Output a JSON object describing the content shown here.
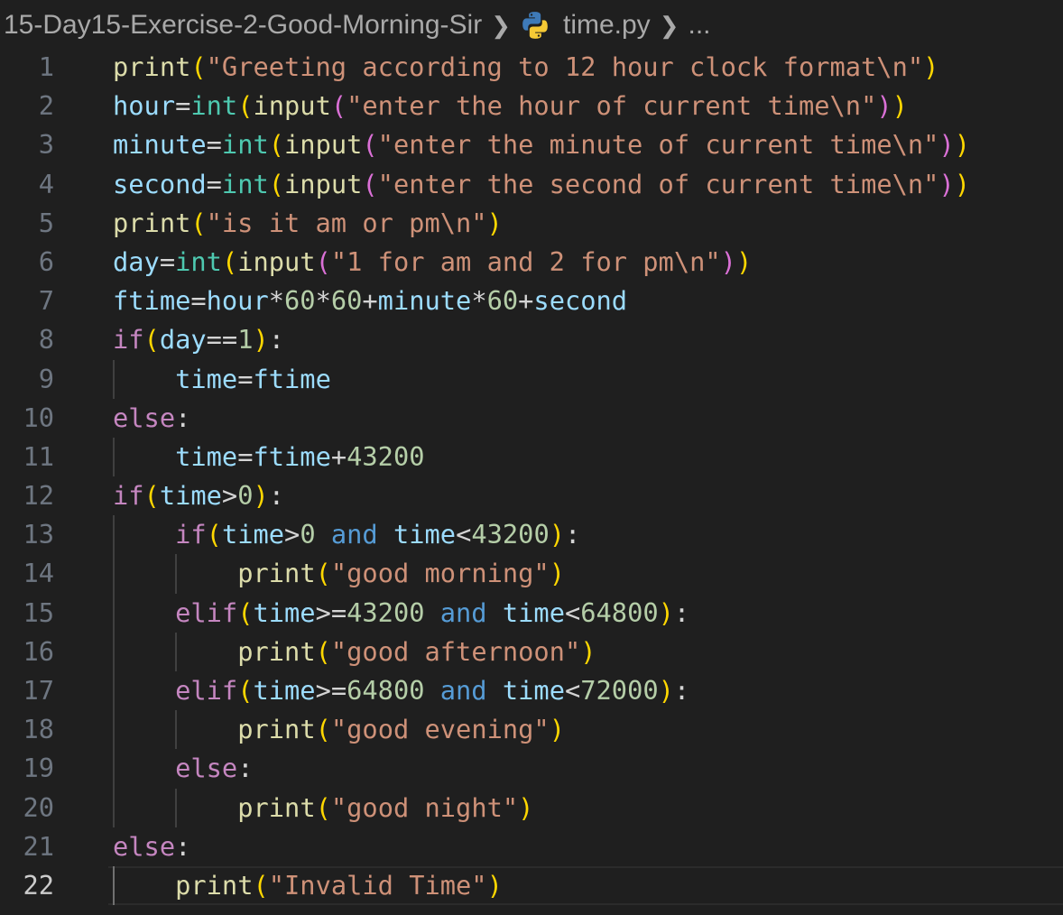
{
  "breadcrumb": {
    "folder": "15-Day15-Exercise-2-Good-Morning-Sir",
    "file": "time.py",
    "file_icon": "python-icon",
    "more": "..."
  },
  "editor": {
    "current_line": 22,
    "colors": {
      "background": "#1f1f1f",
      "function": "#dcdcaa",
      "string": "#ce9178",
      "variable": "#9cdcfe",
      "keyword": "#c586c0",
      "number": "#b5cea8"
    },
    "lines": [
      {
        "n": "1",
        "indent": 0,
        "tokens": [
          [
            "print",
            "fn"
          ],
          [
            "(",
            "b1"
          ],
          [
            "\"Greeting according to 12 hour clock format\\n\"",
            "str"
          ],
          [
            ")",
            "b1"
          ]
        ]
      },
      {
        "n": "2",
        "indent": 0,
        "tokens": [
          [
            "hour",
            "var"
          ],
          [
            "=",
            "op"
          ],
          [
            "int",
            "type"
          ],
          [
            "(",
            "b1"
          ],
          [
            "input",
            "fn"
          ],
          [
            "(",
            "b2"
          ],
          [
            "\"enter the hour of current time\\n\"",
            "str"
          ],
          [
            ")",
            "b2"
          ],
          [
            ")",
            "b1"
          ]
        ]
      },
      {
        "n": "3",
        "indent": 0,
        "tokens": [
          [
            "minute",
            "var"
          ],
          [
            "=",
            "op"
          ],
          [
            "int",
            "type"
          ],
          [
            "(",
            "b1"
          ],
          [
            "input",
            "fn"
          ],
          [
            "(",
            "b2"
          ],
          [
            "\"enter the minute of current time\\n\"",
            "str"
          ],
          [
            ")",
            "b2"
          ],
          [
            ")",
            "b1"
          ]
        ]
      },
      {
        "n": "4",
        "indent": 0,
        "tokens": [
          [
            "second",
            "var"
          ],
          [
            "=",
            "op"
          ],
          [
            "int",
            "type"
          ],
          [
            "(",
            "b1"
          ],
          [
            "input",
            "fn"
          ],
          [
            "(",
            "b2"
          ],
          [
            "\"enter the second of current time\\n\"",
            "str"
          ],
          [
            ")",
            "b2"
          ],
          [
            ")",
            "b1"
          ]
        ]
      },
      {
        "n": "5",
        "indent": 0,
        "tokens": [
          [
            "print",
            "fn"
          ],
          [
            "(",
            "b1"
          ],
          [
            "\"is it am or pm\\n\"",
            "str"
          ],
          [
            ")",
            "b1"
          ]
        ]
      },
      {
        "n": "6",
        "indent": 0,
        "tokens": [
          [
            "day",
            "var"
          ],
          [
            "=",
            "op"
          ],
          [
            "int",
            "type"
          ],
          [
            "(",
            "b1"
          ],
          [
            "input",
            "fn"
          ],
          [
            "(",
            "b2"
          ],
          [
            "\"1 for am and 2 for pm\\n\"",
            "str"
          ],
          [
            ")",
            "b2"
          ],
          [
            ")",
            "b1"
          ]
        ]
      },
      {
        "n": "7",
        "indent": 0,
        "tokens": [
          [
            "ftime",
            "var"
          ],
          [
            "=",
            "op"
          ],
          [
            "hour",
            "var"
          ],
          [
            "*",
            "op"
          ],
          [
            "60",
            "num"
          ],
          [
            "*",
            "op"
          ],
          [
            "60",
            "num"
          ],
          [
            "+",
            "op"
          ],
          [
            "minute",
            "var"
          ],
          [
            "*",
            "op"
          ],
          [
            "60",
            "num"
          ],
          [
            "+",
            "op"
          ],
          [
            "second",
            "var"
          ]
        ]
      },
      {
        "n": "8",
        "indent": 0,
        "tokens": [
          [
            "if",
            "kw"
          ],
          [
            "(",
            "b1"
          ],
          [
            "day",
            "var"
          ],
          [
            "==",
            "op"
          ],
          [
            "1",
            "num"
          ],
          [
            ")",
            "b1"
          ],
          [
            ":",
            "op"
          ]
        ]
      },
      {
        "n": "9",
        "indent": 1,
        "tokens": [
          [
            "time",
            "var"
          ],
          [
            "=",
            "op"
          ],
          [
            "ftime",
            "var"
          ]
        ]
      },
      {
        "n": "10",
        "indent": 0,
        "tokens": [
          [
            "else",
            "kw"
          ],
          [
            ":",
            "op"
          ]
        ]
      },
      {
        "n": "11",
        "indent": 1,
        "tokens": [
          [
            "time",
            "var"
          ],
          [
            "=",
            "op"
          ],
          [
            "ftime",
            "var"
          ],
          [
            "+",
            "op"
          ],
          [
            "43200",
            "num"
          ]
        ]
      },
      {
        "n": "12",
        "indent": 0,
        "tokens": [
          [
            "if",
            "kw"
          ],
          [
            "(",
            "b1"
          ],
          [
            "time",
            "var"
          ],
          [
            ">",
            "op"
          ],
          [
            "0",
            "num"
          ],
          [
            ")",
            "b1"
          ],
          [
            ":",
            "op"
          ]
        ]
      },
      {
        "n": "13",
        "indent": 1,
        "tokens": [
          [
            "if",
            "kw"
          ],
          [
            "(",
            "b1"
          ],
          [
            "time",
            "var"
          ],
          [
            ">",
            "op"
          ],
          [
            "0",
            "num"
          ],
          [
            " ",
            "op"
          ],
          [
            "and",
            "and"
          ],
          [
            " ",
            "op"
          ],
          [
            "time",
            "var"
          ],
          [
            "<",
            "op"
          ],
          [
            "43200",
            "num"
          ],
          [
            ")",
            "b1"
          ],
          [
            ":",
            "op"
          ]
        ]
      },
      {
        "n": "14",
        "indent": 2,
        "tokens": [
          [
            "print",
            "fn"
          ],
          [
            "(",
            "b1"
          ],
          [
            "\"good morning\"",
            "str"
          ],
          [
            ")",
            "b1"
          ]
        ]
      },
      {
        "n": "15",
        "indent": 1,
        "tokens": [
          [
            "elif",
            "kw"
          ],
          [
            "(",
            "b1"
          ],
          [
            "time",
            "var"
          ],
          [
            ">=",
            "op"
          ],
          [
            "43200",
            "num"
          ],
          [
            " ",
            "op"
          ],
          [
            "and",
            "and"
          ],
          [
            " ",
            "op"
          ],
          [
            "time",
            "var"
          ],
          [
            "<",
            "op"
          ],
          [
            "64800",
            "num"
          ],
          [
            ")",
            "b1"
          ],
          [
            ":",
            "op"
          ]
        ]
      },
      {
        "n": "16",
        "indent": 2,
        "tokens": [
          [
            "print",
            "fn"
          ],
          [
            "(",
            "b1"
          ],
          [
            "\"good afternoon\"",
            "str"
          ],
          [
            ")",
            "b1"
          ]
        ]
      },
      {
        "n": "17",
        "indent": 1,
        "tokens": [
          [
            "elif",
            "kw"
          ],
          [
            "(",
            "b1"
          ],
          [
            "time",
            "var"
          ],
          [
            ">=",
            "op"
          ],
          [
            "64800",
            "num"
          ],
          [
            " ",
            "op"
          ],
          [
            "and",
            "and"
          ],
          [
            " ",
            "op"
          ],
          [
            "time",
            "var"
          ],
          [
            "<",
            "op"
          ],
          [
            "72000",
            "num"
          ],
          [
            ")",
            "b1"
          ],
          [
            ":",
            "op"
          ]
        ]
      },
      {
        "n": "18",
        "indent": 2,
        "tokens": [
          [
            "print",
            "fn"
          ],
          [
            "(",
            "b1"
          ],
          [
            "\"good evening\"",
            "str"
          ],
          [
            ")",
            "b1"
          ]
        ]
      },
      {
        "n": "19",
        "indent": 1,
        "tokens": [
          [
            "else",
            "kw"
          ],
          [
            ":",
            "op"
          ]
        ]
      },
      {
        "n": "20",
        "indent": 2,
        "tokens": [
          [
            "print",
            "fn"
          ],
          [
            "(",
            "b1"
          ],
          [
            "\"good night\"",
            "str"
          ],
          [
            ")",
            "b1"
          ]
        ]
      },
      {
        "n": "21",
        "indent": 0,
        "tokens": [
          [
            "else",
            "kw"
          ],
          [
            ":",
            "op"
          ]
        ]
      },
      {
        "n": "22",
        "indent": 1,
        "tokens": [
          [
            "print",
            "fn"
          ],
          [
            "(",
            "b1"
          ],
          [
            "\"Invalid Time\"",
            "str"
          ],
          [
            ")",
            "b1"
          ]
        ]
      }
    ]
  }
}
